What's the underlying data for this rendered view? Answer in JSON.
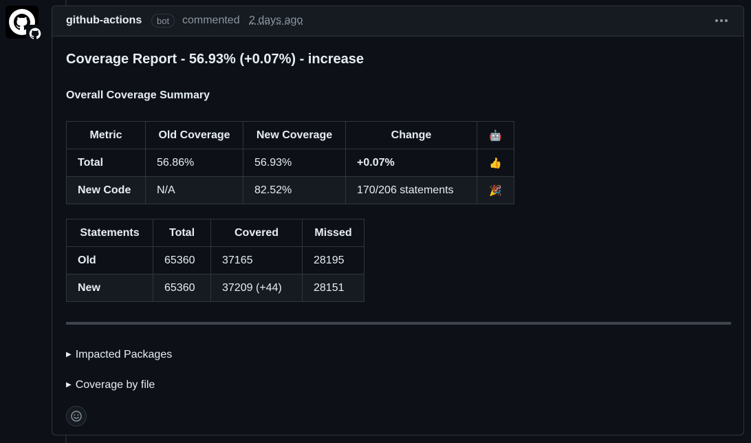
{
  "header": {
    "author": "github-actions",
    "badge": "bot",
    "action": "commented",
    "time": "2 days ago"
  },
  "report": {
    "title": "Coverage Report - 56.93% (+0.07%) - increase",
    "summary_title": "Overall Coverage Summary"
  },
  "summary_table": {
    "headers": [
      "Metric",
      "Old Coverage",
      "New Coverage",
      "Change",
      "🤖"
    ],
    "rows": [
      [
        "Total",
        "56.86%",
        "56.93%",
        "+0.07%",
        "👍"
      ],
      [
        "New Code",
        "N/A",
        "82.52%",
        "170/206 statements",
        "🎉"
      ]
    ]
  },
  "statements_table": {
    "headers": [
      "Statements",
      "Total",
      "Covered",
      "Missed"
    ],
    "rows": [
      [
        "Old",
        "65360",
        "37165",
        "28195"
      ],
      [
        "New",
        "65360",
        "37209 (+44)",
        "28151"
      ]
    ]
  },
  "details": {
    "impacted_packages": "Impacted Packages",
    "coverage_by_file": "Coverage by file",
    "triangle": "▶"
  },
  "icons": {
    "avatar": "github-logo-icon",
    "kebab": "kebab-horizontal-icon",
    "reaction": "smiley-icon"
  }
}
